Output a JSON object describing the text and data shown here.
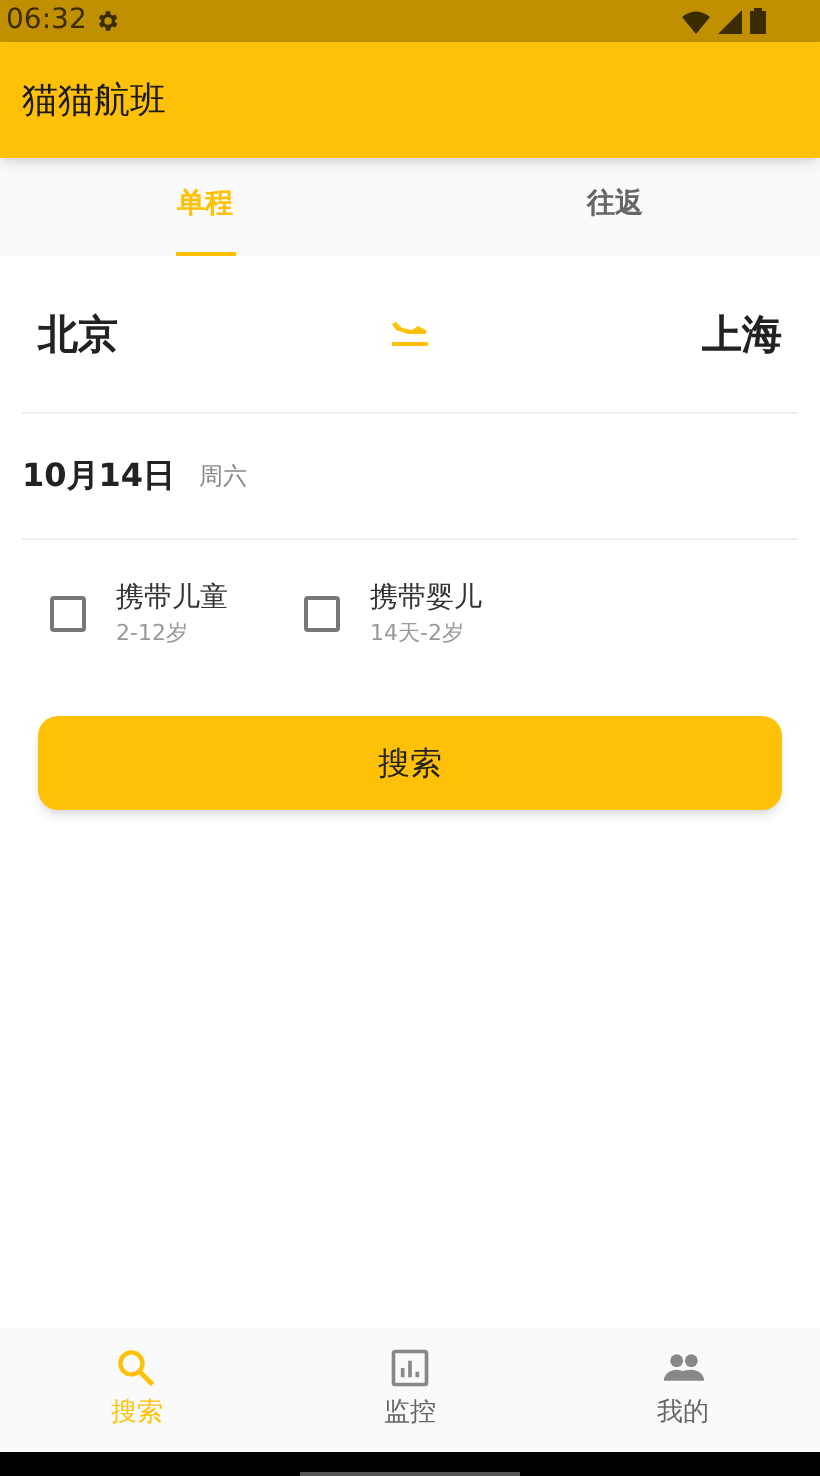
{
  "status_bar": {
    "time": "06:32"
  },
  "app_bar": {
    "title": "猫猫航班"
  },
  "tabs": [
    {
      "label": "单程",
      "selected": true
    },
    {
      "label": "往返",
      "selected": false
    }
  ],
  "route": {
    "from": "北京",
    "to": "上海"
  },
  "date": {
    "day": "10月14日",
    "weekday": "周六"
  },
  "options": [
    {
      "label": "携带儿童",
      "sublabel": "2-12岁",
      "checked": false
    },
    {
      "label": "携带婴儿",
      "sublabel": "14天-2岁",
      "checked": false
    }
  ],
  "search_button": "搜索",
  "bottom_nav": [
    {
      "label": "搜索",
      "selected": true
    },
    {
      "label": "监控",
      "selected": false
    },
    {
      "label": "我的",
      "selected": false
    }
  ]
}
